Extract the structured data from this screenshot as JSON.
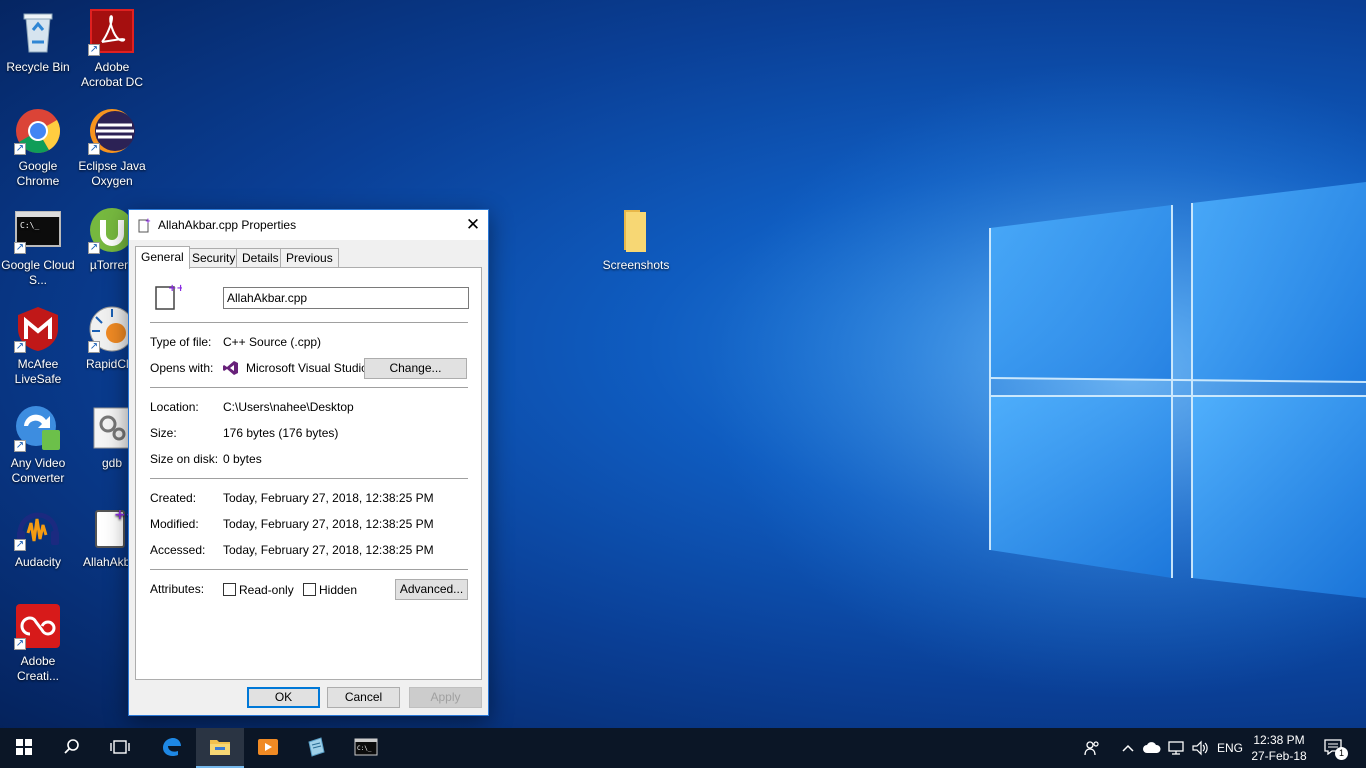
{
  "desktop": {
    "icons": [
      {
        "label": "Recycle Bin"
      },
      {
        "label": "Adobe Acrobat DC"
      },
      {
        "label": "Google Chrome"
      },
      {
        "label": "Eclipse Java Oxygen"
      },
      {
        "label": "Google Cloud S..."
      },
      {
        "label": "µTorrent"
      },
      {
        "label": "McAfee LiveSafe"
      },
      {
        "label": "RapidClip"
      },
      {
        "label": "Any Video Converter"
      },
      {
        "label": "gdb"
      },
      {
        "label": "Audacity"
      },
      {
        "label": "AllahAkbar"
      },
      {
        "label": "Adobe Creati..."
      },
      {
        "label": "Screenshots"
      }
    ]
  },
  "dialog": {
    "title": "AllahAkbar.cpp Properties",
    "close_glyph": "✕",
    "tabs": [
      {
        "label": "General",
        "active": true
      },
      {
        "label": "Security"
      },
      {
        "label": "Details"
      },
      {
        "label": "Previous Versions"
      }
    ],
    "filename": "AllahAkbar.cpp",
    "type_label": "Type of file:",
    "type_value": "C++ Source (.cpp)",
    "opens_label": "Opens with:",
    "opens_value": "Microsoft Visual Studio .",
    "change_button": "Change...",
    "location_label": "Location:",
    "location_value": "C:\\Users\\nahee\\Desktop",
    "size_label": "Size:",
    "size_value": "176 bytes (176 bytes)",
    "size_disk_label": "Size on disk:",
    "size_disk_value": "0 bytes",
    "created_label": "Created:",
    "created_value": "Today, February 27, 2018, 12:38:25 PM",
    "modified_label": "Modified:",
    "modified_value": "Today, February 27, 2018, 12:38:25 PM",
    "accessed_label": "Accessed:",
    "accessed_value": "Today, February 27, 2018, 12:38:25 PM",
    "attributes_label": "Attributes:",
    "readonly_label": "Read-only",
    "hidden_label": "Hidden",
    "advanced_button": "Advanced...",
    "ok_button": "OK",
    "cancel_button": "Cancel",
    "apply_button": "Apply"
  },
  "taskbar": {
    "language": "ENG",
    "time": "12:38 PM",
    "date": "27-Feb-18",
    "notification_count": "1"
  },
  "colors": {
    "accent": "#0078d7",
    "taskbar": "#0b1626",
    "dialog_border": "#2b79d7"
  }
}
